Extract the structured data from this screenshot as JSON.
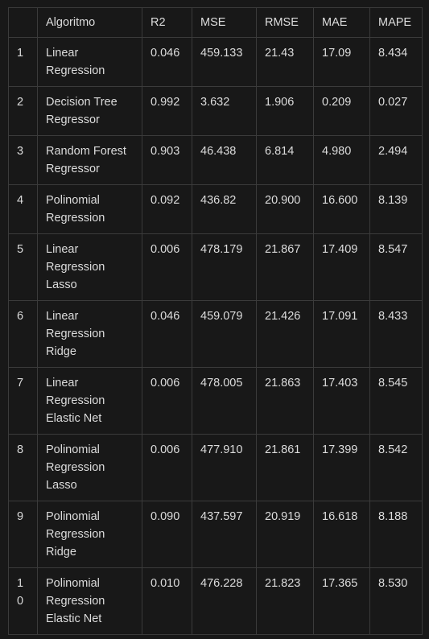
{
  "table": {
    "headers": [
      "",
      "Algoritmo",
      "R2",
      "MSE",
      "RMSE",
      "MAE",
      "MAPE"
    ],
    "rows": [
      [
        "1",
        "Linear Regression",
        "0.046",
        "459.133",
        "21.43",
        "17.09",
        "8.434"
      ],
      [
        "2",
        "Decision Tree Regressor",
        "0.992",
        "3.632",
        "1.906",
        "0.209",
        "0.027"
      ],
      [
        "3",
        "Random Forest Regressor",
        "0.903",
        "46.438",
        "6.814",
        "4.980",
        "2.494"
      ],
      [
        "4",
        "Polinomial Regression",
        "0.092",
        "436.82",
        "20.900",
        "16.600",
        "8.139"
      ],
      [
        "5",
        "Linear Regression Lasso",
        "0.006",
        "478.179",
        "21.867",
        "17.409",
        "8.547"
      ],
      [
        "6",
        "Linear Regression Ridge",
        "0.046",
        "459.079",
        "21.426",
        "17.091",
        "8.433"
      ],
      [
        "7",
        "Linear Regression Elastic Net",
        "0.006",
        "478.005",
        "21.863",
        "17.403",
        "8.545"
      ],
      [
        "8",
        "Polinomial Regression Lasso",
        "0.006",
        "477.910",
        "21.861",
        "17.399",
        "8.542"
      ],
      [
        "9",
        "Polinomial Regression Ridge",
        "0.090",
        "437.597",
        "20.919",
        "16.618",
        "8.188"
      ],
      [
        "10",
        "Polinomial Regression Elastic Net",
        "0.010",
        "476.228",
        "21.823",
        "17.365",
        "8.530"
      ]
    ]
  }
}
